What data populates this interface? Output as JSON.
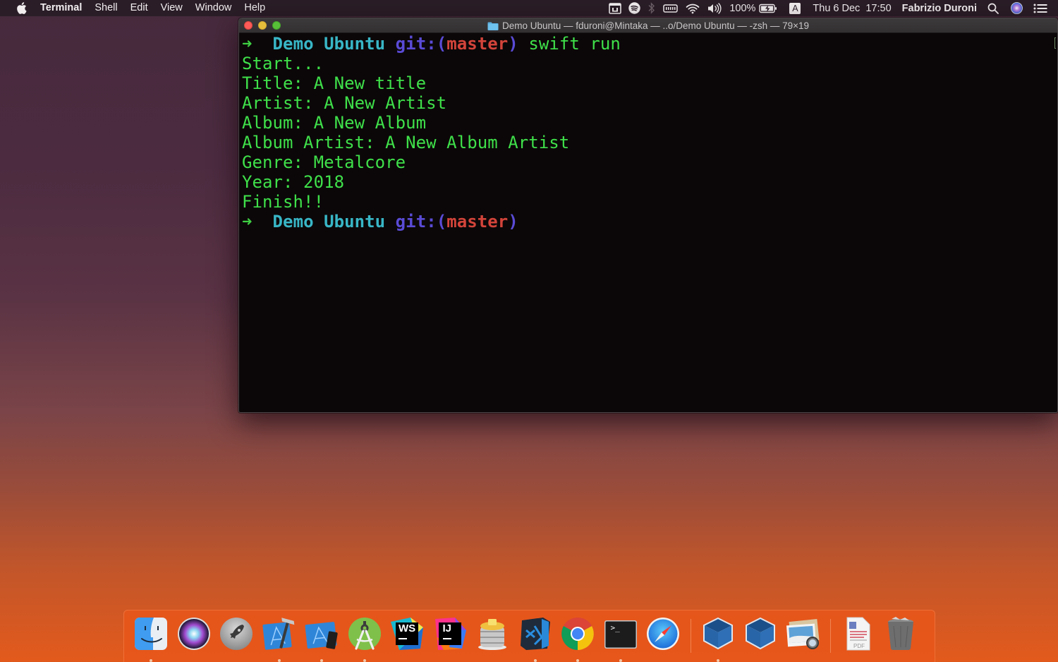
{
  "menubar": {
    "apple_icon": "apple-logo-icon",
    "app_name": "Terminal",
    "menus": [
      "Shell",
      "Edit",
      "View",
      "Window",
      "Help"
    ],
    "status": {
      "icons": [
        "notes-widget-icon",
        "spotify-icon",
        "bluetooth-icon",
        "keyboard-battery-icon",
        "wifi-icon",
        "volume-icon"
      ],
      "battery_percent": "100%",
      "battery_icon": "battery-charging-icon",
      "input_source": "A",
      "datetime": "Thu 6 Dec  17:50",
      "user": "Fabrizio Duroni",
      "trailing_icons": [
        "spotlight-search-icon",
        "siri-icon",
        "notification-center-icon"
      ]
    }
  },
  "terminal": {
    "window_title": "Demo Ubuntu — fduroni@Mintaka — ..o/Demo Ubuntu — -zsh — 79×19",
    "prompt": {
      "arrow": "➜",
      "directory": "Demo Ubuntu",
      "git_label": "git:(",
      "branch": "master",
      "git_close": ")"
    },
    "command": "swift run",
    "output": [
      "Start...",
      "Title: A New title",
      "Artist: A New Artist",
      "Album: A New Album",
      "Album Artist: A New Album Artist",
      "Genre: Metalcore",
      "Year: 2018",
      "Finish!!"
    ],
    "colors": {
      "background": "#0b0708",
      "output_green": "#3fe04a",
      "directory_cyan": "#38b6c6",
      "git_purple": "#5a4bd6",
      "branch_red": "#d3443a"
    }
  },
  "dock": {
    "apps": [
      {
        "name": "Finder",
        "icon": "finder-icon",
        "running": true
      },
      {
        "name": "Siri",
        "icon": "siri-icon",
        "running": false
      },
      {
        "name": "Launchpad",
        "icon": "launchpad-icon",
        "running": false
      },
      {
        "name": "Xcode",
        "icon": "xcode-icon",
        "running": true
      },
      {
        "name": "Simulator",
        "icon": "simulator-icon",
        "running": true
      },
      {
        "name": "Android Studio",
        "icon": "android-studio-icon",
        "running": true
      },
      {
        "name": "WebStorm",
        "icon": "webstorm-icon",
        "running": false,
        "label": "WS"
      },
      {
        "name": "IntelliJ IDEA",
        "icon": "intellij-icon",
        "running": false,
        "label": "IJ"
      },
      {
        "name": "Sequel Pro",
        "icon": "sequel-pro-icon",
        "running": false
      },
      {
        "name": "Visual Studio Code",
        "icon": "vscode-icon",
        "running": true
      },
      {
        "name": "Google Chrome",
        "icon": "chrome-icon",
        "running": true
      },
      {
        "name": "Terminal",
        "icon": "terminal-icon",
        "running": true,
        "label": ">_"
      },
      {
        "name": "Safari",
        "icon": "safari-icon",
        "running": false
      }
    ],
    "apps_group2": [
      {
        "name": "VirtualBox",
        "icon": "virtualbox-icon",
        "running": true
      },
      {
        "name": "VirtualBox VM",
        "icon": "virtualbox-vm-icon",
        "running": false
      },
      {
        "name": "Preview",
        "icon": "preview-icon",
        "running": false
      }
    ],
    "stack": [
      {
        "name": "Documents",
        "icon": "pdf-document-icon",
        "label": "PDF"
      },
      {
        "name": "Trash",
        "icon": "trash-icon"
      }
    ]
  }
}
